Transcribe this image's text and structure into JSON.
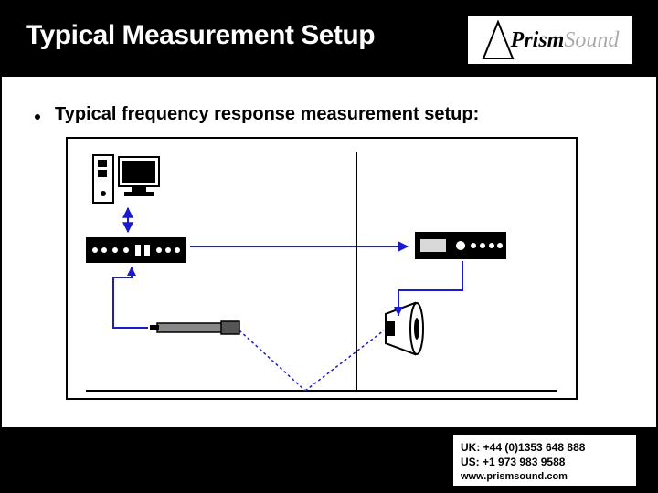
{
  "header": {
    "title": "Typical Measurement Setup",
    "logo_main": "Prism",
    "logo_sub": "Sound"
  },
  "content": {
    "bullet": "Typical frequency response measurement setup:",
    "devices": {
      "computer": "computer",
      "analyzer": "audio-analyzer",
      "amplifier": "amplifier",
      "microphone": "measurement-microphone",
      "speaker": "loudspeaker",
      "floor": "reflective-floor"
    }
  },
  "footer": {
    "uk": "UK: +44 (0)1353 648 888",
    "us": "US: +1 973 983 9588",
    "web": "www.prismsound.com"
  },
  "colors": {
    "wire": "#1a1acf",
    "reflect": "#1a1acf"
  }
}
